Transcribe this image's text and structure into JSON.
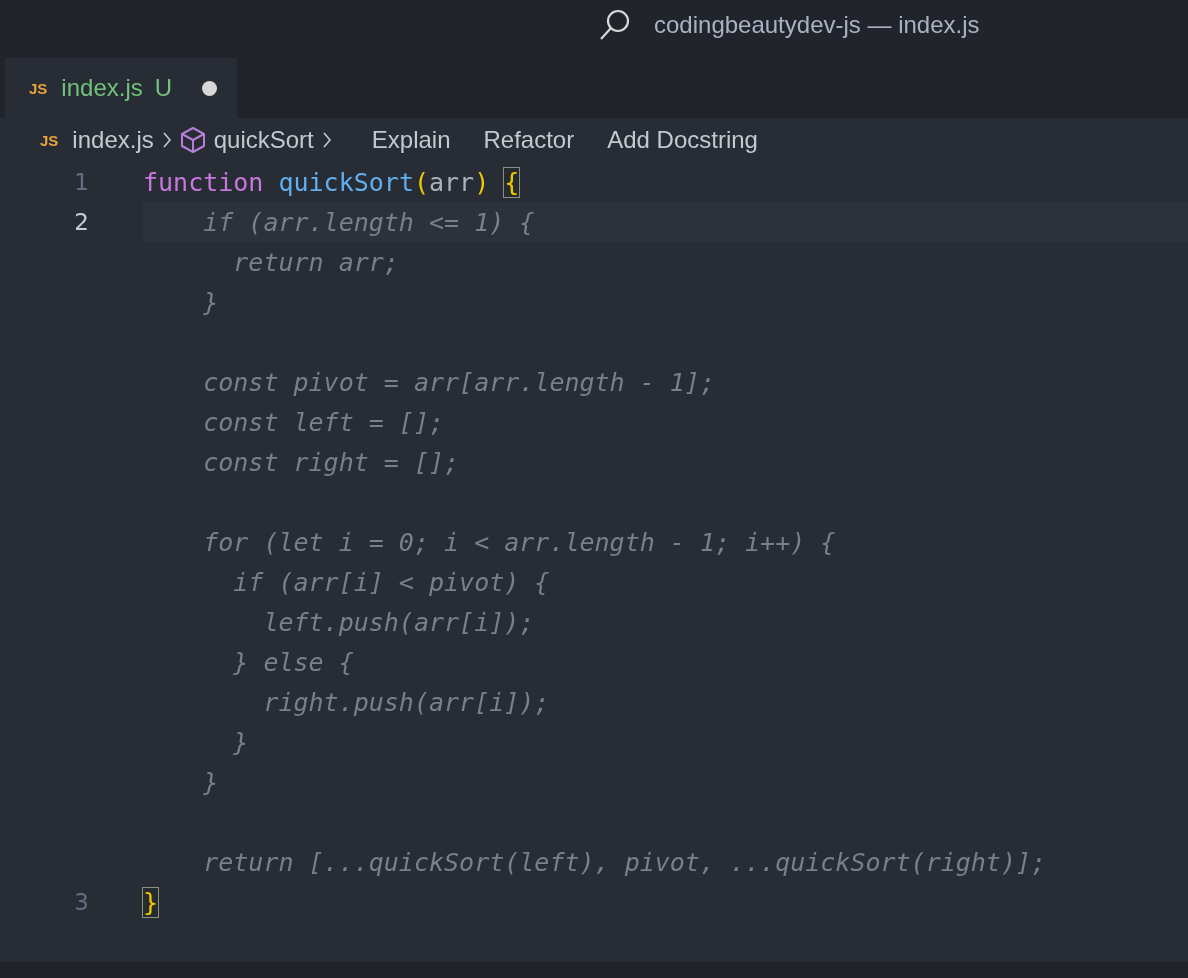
{
  "window": {
    "title": "codingbeautydev-js — index.js"
  },
  "tabs": [
    {
      "icon": "JS",
      "label": "index.js",
      "status": "U",
      "modified": true,
      "selected": true
    }
  ],
  "breadcrumb": {
    "icon": "JS",
    "file": "index.js",
    "symbol": "quickSort",
    "actions": [
      "Explain",
      "Refactor",
      "Add Docstring"
    ]
  },
  "lines": [
    {
      "kind": "code",
      "number": "1",
      "current": false,
      "tokens": [
        {
          "kind": "keyword",
          "text": "function"
        },
        {
          "kind": "function",
          "text": "quickSort",
          "spaced": true
        },
        {
          "kind": "paren",
          "text": "("
        },
        {
          "kind": "param",
          "text": "arr"
        },
        {
          "kind": "paren",
          "text": ")"
        },
        {
          "kind": "matched-brace",
          "text": "{",
          "spaced": true
        }
      ]
    },
    {
      "kind": "code",
      "number": "2",
      "current": true,
      "tokens": [
        {
          "kind": "ghost",
          "text": "    if (arr.length <= 1) {"
        }
      ]
    },
    {
      "kind": "ghost",
      "text": "      return arr;"
    },
    {
      "kind": "ghost",
      "text": "    }"
    },
    {
      "kind": "blank"
    },
    {
      "kind": "ghost",
      "text": "    const pivot = arr[arr.length - 1];"
    },
    {
      "kind": "ghost",
      "text": "    const left = [];"
    },
    {
      "kind": "ghost",
      "text": "    const right = [];"
    },
    {
      "kind": "blank"
    },
    {
      "kind": "ghost",
      "text": "    for (let i = 0; i < arr.length - 1; i++) {"
    },
    {
      "kind": "ghost",
      "text": "      if (arr[i] < pivot) {"
    },
    {
      "kind": "ghost",
      "text": "        left.push(arr[i]);"
    },
    {
      "kind": "ghost",
      "text": "      } else {"
    },
    {
      "kind": "ghost",
      "text": "        right.push(arr[i]);"
    },
    {
      "kind": "ghost",
      "text": "      }"
    },
    {
      "kind": "ghost",
      "text": "    }"
    },
    {
      "kind": "blank"
    },
    {
      "kind": "ghost",
      "text": "    return [...quickSort(left), pivot, ...quickSort(right)];"
    },
    {
      "kind": "code",
      "number": "3",
      "current": false,
      "tokens": [
        {
          "kind": "matched-brace",
          "text": "}"
        }
      ]
    }
  ]
}
